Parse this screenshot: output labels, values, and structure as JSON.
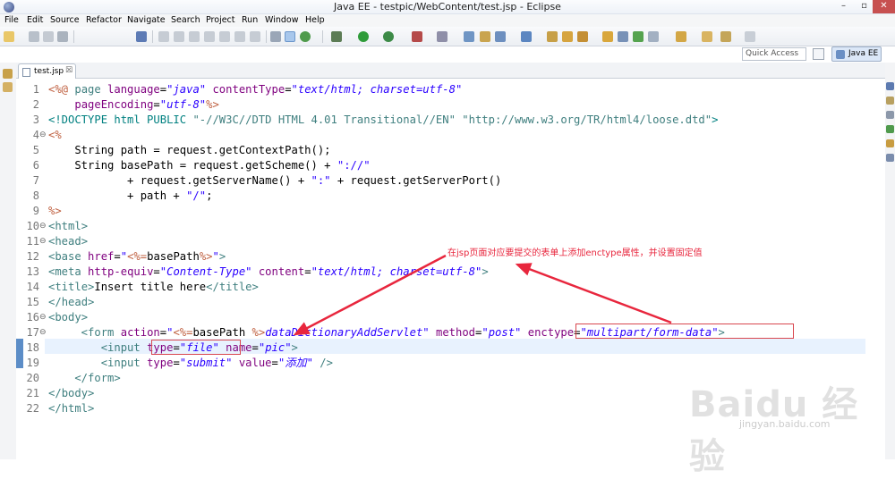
{
  "window": {
    "title": "Java EE - testpic/WebContent/test.jsp - Eclipse",
    "minimize": "–",
    "maximize": "▫",
    "close": "✕"
  },
  "menu": [
    "File",
    "Edit",
    "Source",
    "Refactor",
    "Navigate",
    "Search",
    "Project",
    "Run",
    "Window",
    "Help"
  ],
  "quick_access": {
    "placeholder": "Quick Access"
  },
  "perspective": {
    "label": "Java EE"
  },
  "editor_tab": {
    "label": "test.jsp",
    "close": "☒"
  },
  "line_numbers": [
    "1",
    "2",
    "3",
    "4",
    "5",
    "6",
    "7",
    "8",
    "9",
    "10",
    "11",
    "12",
    "13",
    "14",
    "15",
    "16",
    "17",
    "18",
    "19",
    "20",
    "21",
    "22"
  ],
  "fold_markers": {
    "4": "⊖",
    "10": "⊖",
    "11": "⊖",
    "16": "⊖",
    "17": "⊖"
  },
  "code": {
    "l1": [
      "<%@",
      " page ",
      "language",
      "=",
      "\"java\"",
      " ",
      "contentType",
      "=",
      "\"text/html; charset=utf-8\""
    ],
    "l2": [
      "    ",
      "pageEncoding",
      "=",
      "\"utf-8\"",
      "%>"
    ],
    "l3": [
      "<!DOCTYPE html PUBLIC ",
      "\"-//W3C//DTD HTML 4.01 Transitional//EN\"",
      " ",
      "\"http://www.w3.org/TR/html4/loose.dtd\"",
      ">"
    ],
    "l4": "<%",
    "l5": "    String path = request.getContextPath();",
    "l6": [
      "    String basePath = request.getScheme() + ",
      "\"://\""
    ],
    "l7": [
      "            + request.getServerName() + ",
      "\":\"",
      " + request.getServerPort()"
    ],
    "l8": [
      "            + path + ",
      "\"/\"",
      ";"
    ],
    "l9": "%>",
    "l10": [
      "<",
      "html",
      ">"
    ],
    "l11": [
      "<",
      "head",
      ">"
    ],
    "l12": [
      "<",
      "base",
      " ",
      "href",
      "=",
      "\"",
      "<%=",
      "basePath",
      "%>",
      "\"",
      ">"
    ],
    "l13": [
      "<",
      "meta",
      " ",
      "http-equiv",
      "=",
      "\"Content-Type\"",
      " ",
      "content",
      "=",
      "\"text/html; charset=utf-8\"",
      ">"
    ],
    "l14": [
      "<",
      "title",
      ">",
      "Insert title here",
      "</",
      "title",
      ">"
    ],
    "l15": [
      "</",
      "head",
      ">"
    ],
    "l16": [
      "<",
      "body",
      ">"
    ],
    "l17": [
      "     <",
      "form",
      " ",
      "action",
      "=",
      "\"",
      "<%=",
      "basePath ",
      "%>",
      "dataDictionaryAddServlet\"",
      " ",
      "method",
      "=",
      "\"post\"",
      " ",
      "enctype",
      "=",
      "\"multipart/form-data\"",
      ">"
    ],
    "l18": [
      "        <",
      "input",
      " ",
      "type",
      "=",
      "\"file\"",
      " ",
      "name",
      "=",
      "\"pic\"",
      ">"
    ],
    "l19": [
      "        <",
      "input",
      " ",
      "type",
      "=",
      "\"submit\"",
      " ",
      "value",
      "=",
      "\"添加\"",
      " />"
    ],
    "l20": [
      "    </",
      "form",
      ">"
    ],
    "l21": [
      "</",
      "body",
      ">"
    ],
    "l22": [
      "</",
      "html",
      ">"
    ]
  },
  "annotation": {
    "text": "在jsp页面对应要提交的表单上添加enctype属性，并设置固定值"
  },
  "watermark": {
    "logo": "Baidu 经验",
    "url": "jingyan.baidu.com"
  },
  "colors": {
    "tag": "#3f7f7f",
    "attr": "#7f007f",
    "value": "#2a00ff",
    "jsp": "#bf5f3f",
    "annotation": "#e8263d"
  }
}
